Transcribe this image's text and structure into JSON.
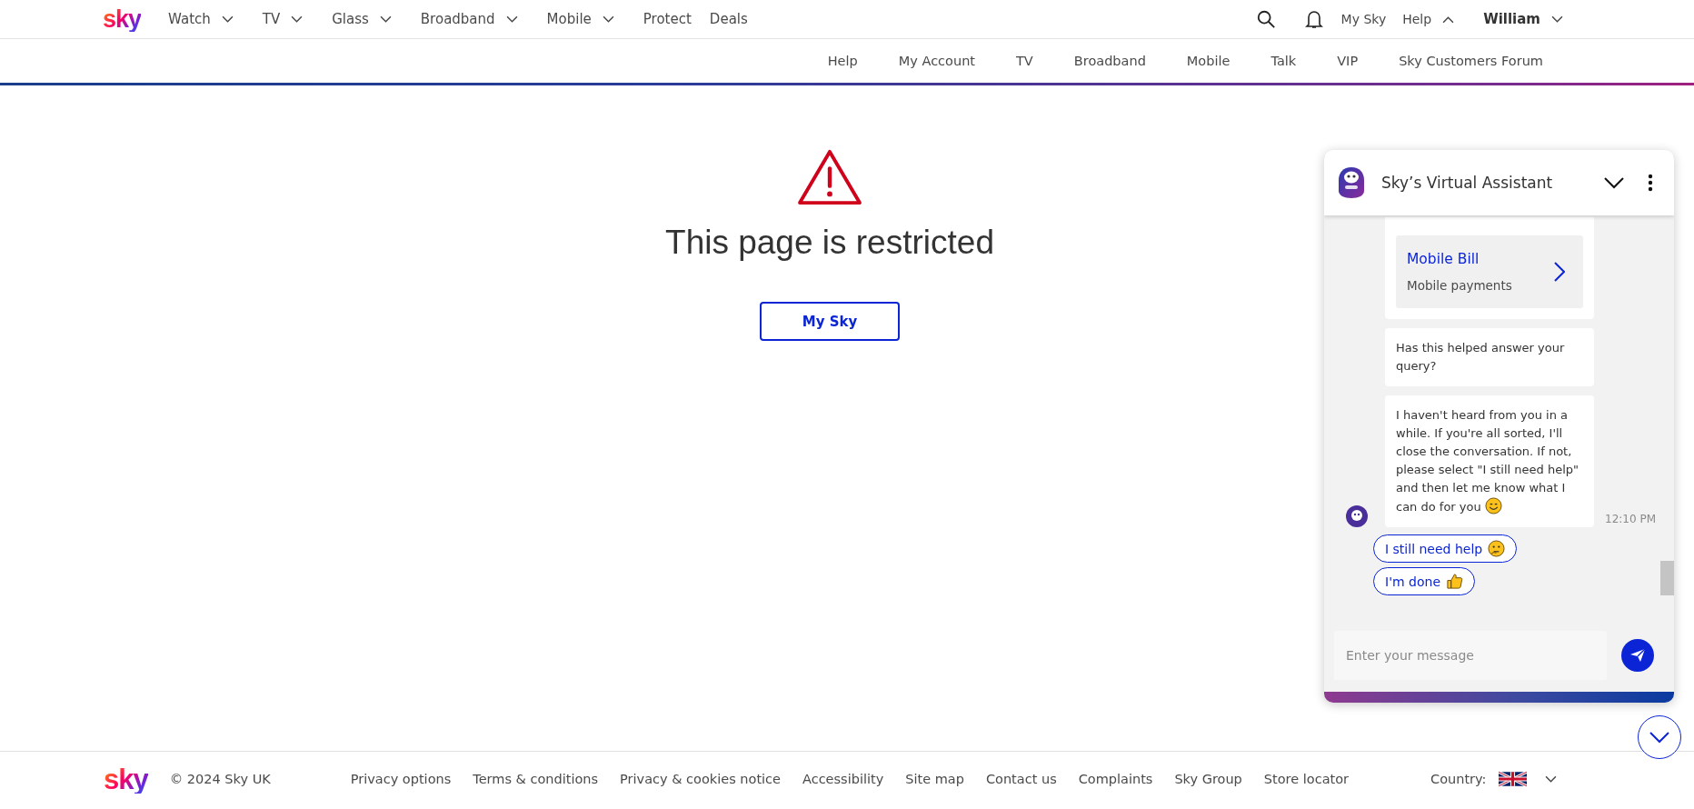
{
  "header": {
    "logo": "sky",
    "nav": [
      {
        "label": "Watch",
        "dropdown": true
      },
      {
        "label": "TV",
        "dropdown": true
      },
      {
        "label": "Glass",
        "dropdown": true
      },
      {
        "label": "Broadband",
        "dropdown": true
      },
      {
        "label": "Mobile",
        "dropdown": true
      },
      {
        "label": "Protect",
        "dropdown": false
      },
      {
        "label": "Deals",
        "dropdown": false
      }
    ],
    "my_sky": "My Sky",
    "help": {
      "label": "Help",
      "expanded": true
    },
    "user": {
      "label": "William",
      "expanded": false
    }
  },
  "subnav": [
    "Help",
    "My Account",
    "TV",
    "Broadband",
    "Mobile",
    "Talk",
    "VIP",
    "Sky Customers Forum"
  ],
  "main": {
    "title": "This page is restricted",
    "button": "My Sky"
  },
  "chat": {
    "title": "Sky’s Virtual Assistant",
    "card": {
      "title": "Mobile Bill",
      "subtitle": "Mobile payments"
    },
    "messages": [
      {
        "text": "Has this helped answer your query?",
        "kind": "plain"
      },
      {
        "text": "I haven't heard from you in a while. If you're all sorted, I'll close the conversation. If not, please select \"I still need help\" and then let me know what I can do for you",
        "kind": "smile",
        "time": "12:10 PM"
      }
    ],
    "quick_replies": [
      {
        "label": "I still need help",
        "kind": "thinking"
      },
      {
        "label": "I'm done",
        "kind": "thumbs"
      }
    ],
    "input": {
      "placeholder": "Enter your message"
    }
  },
  "footer": {
    "logo": "sky",
    "copyright": "© 2024 Sky UK",
    "links": [
      "Privacy options",
      "Terms & conditions",
      "Privacy & cookies notice",
      "Accessibility",
      "Site map",
      "Contact us",
      "Complaints",
      "Sky Group",
      "Store locator"
    ],
    "country": "Country:"
  }
}
